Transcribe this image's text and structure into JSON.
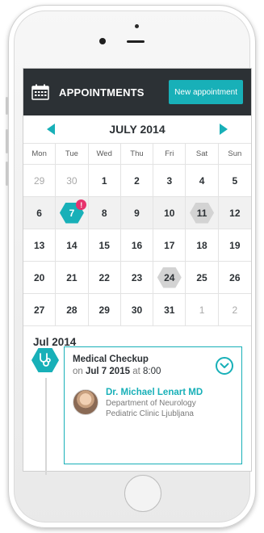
{
  "header": {
    "title": "APPOINTMENTS",
    "new_button": "New appointment",
    "icon": "calendar-icon"
  },
  "calendar": {
    "month_title": "JULY 2014",
    "weekdays": [
      "Mon",
      "Tue",
      "Wed",
      "Thu",
      "Fri",
      "Sat",
      "Sun"
    ],
    "weeks": [
      [
        "29",
        "30",
        "1",
        "2",
        "3",
        "4",
        "5"
      ],
      [
        "6",
        "7",
        "8",
        "9",
        "10",
        "11",
        "12"
      ],
      [
        "13",
        "14",
        "15",
        "16",
        "17",
        "18",
        "19"
      ],
      [
        "20",
        "21",
        "22",
        "23",
        "24",
        "25",
        "26"
      ],
      [
        "27",
        "28",
        "29",
        "30",
        "31",
        "1",
        "2"
      ]
    ],
    "selected_day": "7",
    "selected_badge": "!",
    "highlighted_days": [
      "11",
      "24"
    ]
  },
  "list": {
    "month_label": "Jul 2014",
    "appointment": {
      "title": "Medical Checkup",
      "on": "on",
      "date": "Jul 7 2015",
      "at": "at",
      "time": "8:00",
      "doctor_name": "Dr. Michael Lenart MD",
      "department": "Department of Neurology",
      "clinic": "Pediatric Clinic Ljubljana",
      "icon": "stethoscope-icon"
    }
  },
  "colors": {
    "accent": "#18b0b8",
    "header_bg": "#2c3135",
    "badge": "#e7336d",
    "highlight": "#d3d3d3"
  }
}
